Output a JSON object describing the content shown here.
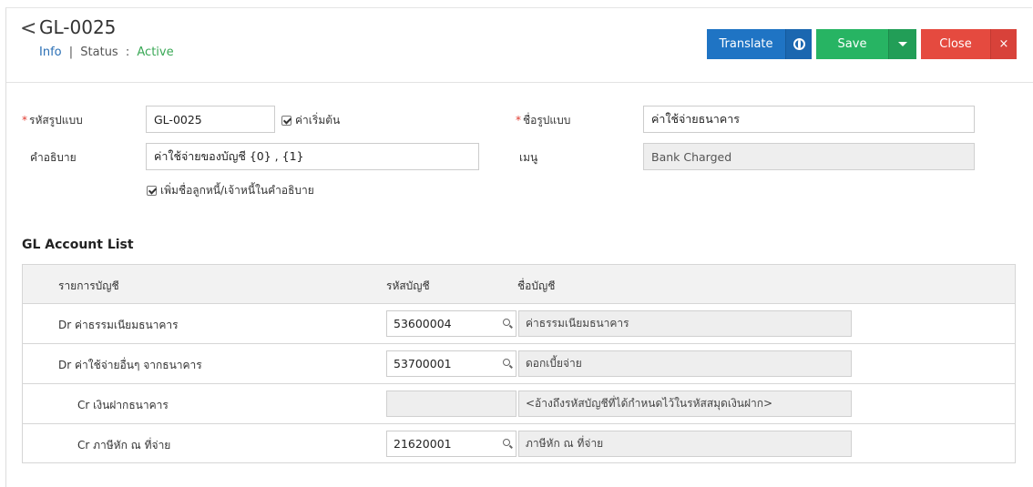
{
  "header": {
    "title": "GL-0025",
    "info_link": "Info",
    "separator": "|",
    "status_label": "Status",
    "status_colon": ":",
    "status_value": "Active",
    "translate_label": "Translate",
    "save_label": "Save",
    "close_label": "Close",
    "close_x": "×",
    "back_glyph": "<"
  },
  "form": {
    "code_label": "รหัสรูปแบบ",
    "code_value": "GL-0025",
    "default_label": "ค่าเริ่มต้น",
    "name_label": "ชื่อรูปแบบ",
    "name_value": "ค่าใช้จ่ายธนาคาร",
    "desc_label": "คำอธิบาย",
    "desc_value": "ค่าใช้จ่ายของบัญชี {0} , {1}",
    "menu_label": "เมนู",
    "menu_value": "Bank Charged",
    "add_name_label": "เพิ่มชื่อลูกหนี้/เจ้าหนี้ในคำอธิบาย",
    "required_mark": "*"
  },
  "account_list": {
    "title": "GL Account List",
    "columns": [
      "รายการบัญชี",
      "รหัสบัญชี",
      "ชื่อบัญชี"
    ],
    "rows": [
      {
        "item": "Dr ค่าธรรมเนียมธนาคาร",
        "code": "53600004",
        "name": "ค่าธรรมเนียมธนาคาร"
      },
      {
        "item": "Dr ค่าใช้จ่ายอื่นๆ จากธนาคาร",
        "code": "53700001",
        "name": "ดอกเบี้ยจ่าย"
      },
      {
        "item": "Cr เงินฝากธนาคาร",
        "code": "",
        "name": "<อ้างถึงรหัสบัญชีที่ได้กำหนดไว้ในรหัสสมุดเงินฝาก>"
      },
      {
        "item": "Cr ภาษีหัก ณ ที่จ่าย",
        "code": "21620001",
        "name": "ภาษีหัก ณ ที่จ่าย"
      }
    ]
  },
  "colors": {
    "translate": "#1f74c4",
    "save": "#27b463",
    "close": "#e54a3f",
    "status_active": "#3aa856",
    "required": "#e03a2f"
  },
  "icons": [
    "back-chevron-icon",
    "globe-icon",
    "caret-down-icon",
    "close-x-icon",
    "checkbox-checked-icon",
    "search-icon"
  ]
}
